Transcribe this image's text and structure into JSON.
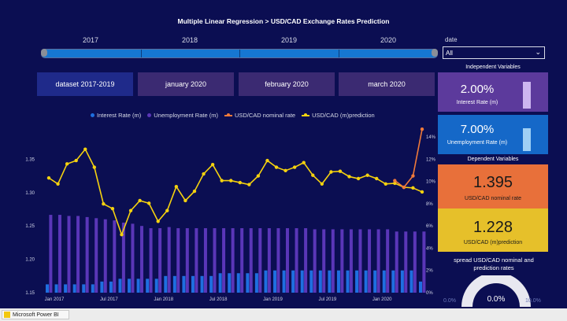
{
  "title": "Multiple Linear Regression > USD/CAD Exchange Rates Prediction",
  "timeline": {
    "years": [
      "2017",
      "2018",
      "2019",
      "2020"
    ]
  },
  "buttons": [
    "dataset 2017-2019",
    "january 2020",
    "february 2020",
    "march 2020"
  ],
  "date_filter": {
    "label": "date",
    "value": "All"
  },
  "independent": {
    "header": "Independent Variables",
    "interest": {
      "value": "2.00%",
      "label": "Interest Rate (m)",
      "level": 0.8,
      "color": "#5c3a9c"
    },
    "unemployment": {
      "value": "7.00%",
      "label": "Unemployment Rate (m)",
      "level": 0.7,
      "color": "#1568c8"
    }
  },
  "dependent": {
    "header": "Dependent Variables",
    "nominal": {
      "value": "1.395",
      "label": "USD/CAD nominal rate",
      "color": "#e8703a"
    },
    "prediction": {
      "value": "1.228",
      "label": "USD/CAD (m)prediction",
      "color": "#e6c02a"
    }
  },
  "spread": {
    "title": "spread USD/CAD nominal and prediction rates",
    "value": "0.0%",
    "min": "0.0%",
    "max": "10.0%"
  },
  "taskbar": {
    "app": "Microsoft Power BI"
  },
  "colors": {
    "interest": "#1e6fe0",
    "unemployment": "#5a36b8",
    "nominal": "#f07a3a",
    "prediction": "#f5d20f"
  },
  "chart_data": {
    "type": "bar",
    "legend": [
      "Interest Rate (m)",
      "Unemployment Rate (m)",
      "USD/CAD nominal rate",
      "USD/CAD (m)prediction"
    ],
    "x_tick_labels": [
      "Jan 2017",
      "Jul 2017",
      "Jan 2018",
      "Jul 2018",
      "Jan 2019",
      "Jul 2019",
      "Jan 2020"
    ],
    "y_left": {
      "ticks": [
        "1.15",
        "1.20",
        "1.25",
        "1.30",
        "1.35"
      ],
      "ylim": [
        1.15,
        1.4
      ]
    },
    "y_right": {
      "ticks": [
        "0%",
        "2%",
        "4%",
        "6%",
        "8%",
        "10%",
        "12%",
        "14%"
      ],
      "ylim": [
        0,
        15
      ]
    },
    "series": [
      {
        "name": "Interest Rate (m)",
        "axis": "right",
        "values": [
          0.75,
          0.75,
          0.75,
          0.75,
          0.75,
          0.75,
          1.0,
          1.0,
          1.25,
          1.25,
          1.25,
          1.25,
          1.25,
          1.5,
          1.5,
          1.5,
          1.5,
          1.5,
          1.5,
          1.75,
          1.75,
          1.75,
          1.75,
          1.75,
          2.0,
          2.0,
          2.0,
          2.0,
          2.0,
          2.0,
          2.0,
          2.0,
          2.0,
          2.0,
          2.0,
          2.0,
          2.0,
          2.0,
          2.0,
          2.0,
          2.0,
          1.0
        ]
      },
      {
        "name": "Unemployment Rate (m)",
        "axis": "right",
        "values": [
          7.0,
          7.0,
          6.9,
          6.9,
          6.8,
          6.7,
          6.6,
          6.5,
          6.3,
          6.2,
          6.0,
          5.8,
          5.8,
          5.9,
          5.8,
          5.8,
          5.8,
          5.8,
          5.8,
          5.8,
          5.8,
          5.8,
          5.8,
          5.8,
          5.8,
          5.8,
          5.8,
          5.8,
          5.8,
          5.7,
          5.7,
          5.7,
          5.7,
          5.7,
          5.7,
          5.7,
          5.7,
          5.7,
          5.5,
          5.5,
          5.5,
          5.5
        ]
      },
      {
        "name": "USD/CAD nominal rate",
        "axis": "left",
        "values": [
          null,
          null,
          null,
          null,
          null,
          null,
          null,
          null,
          null,
          null,
          null,
          null,
          null,
          null,
          null,
          null,
          null,
          null,
          null,
          null,
          null,
          null,
          null,
          null,
          null,
          null,
          null,
          null,
          null,
          null,
          null,
          null,
          null,
          null,
          null,
          null,
          null,
          null,
          1.318,
          1.308,
          1.325,
          1.395
        ]
      },
      {
        "name": "USD/CAD (m)prediction",
        "axis": "left",
        "values": [
          1.322,
          1.313,
          1.343,
          1.348,
          1.365,
          1.338,
          1.283,
          1.276,
          1.237,
          1.273,
          1.288,
          1.284,
          1.257,
          1.273,
          1.309,
          1.288,
          1.302,
          1.328,
          1.342,
          1.318,
          1.318,
          1.315,
          1.312,
          1.325,
          1.348,
          1.338,
          1.333,
          1.338,
          1.345,
          1.326,
          1.313,
          1.331,
          1.332,
          1.324,
          1.321,
          1.326,
          1.321,
          1.313,
          1.314,
          1.308,
          1.307,
          1.301
        ]
      }
    ]
  }
}
